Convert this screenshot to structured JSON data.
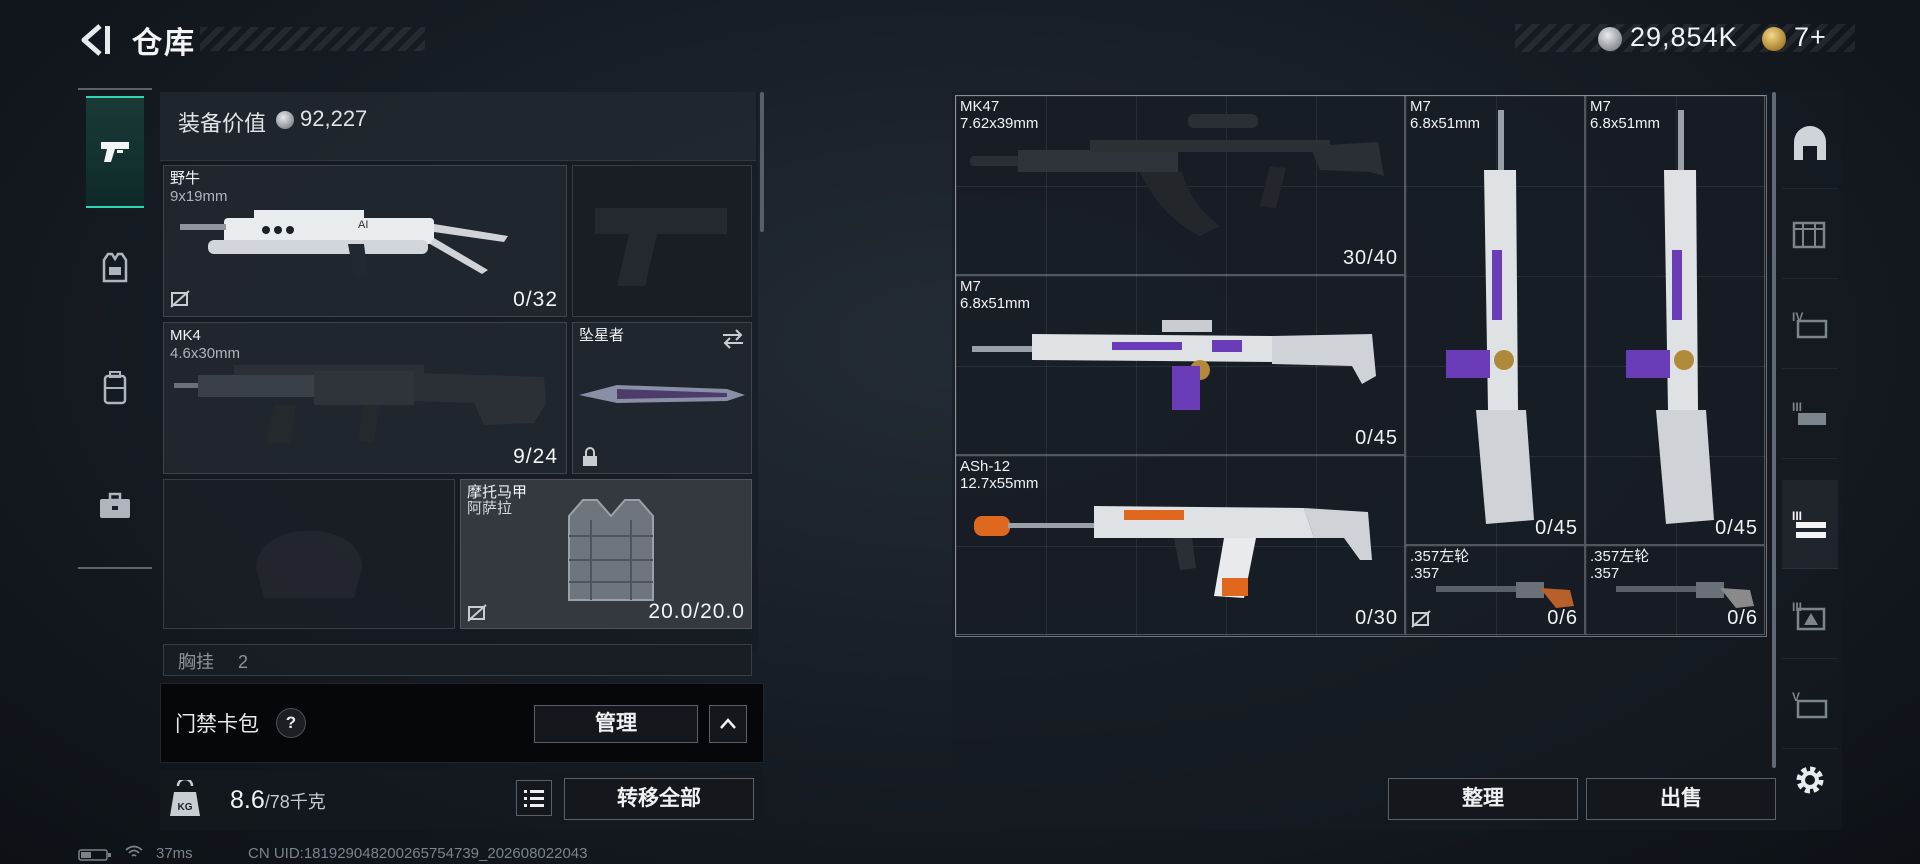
{
  "header": {
    "title": "仓库",
    "currency": [
      {
        "icon": "silver-coin-icon",
        "value": "29,854K"
      },
      {
        "icon": "gold-coin-icon",
        "value": "7+"
      }
    ]
  },
  "left_rail": {
    "tabs": [
      {
        "name": "weapons-tab",
        "icon": "pistol-icon",
        "active": true
      },
      {
        "name": "armor-tab",
        "icon": "vest-icon",
        "active": false
      },
      {
        "name": "backpack-tab",
        "icon": "backpack-icon",
        "active": false
      },
      {
        "name": "case-tab",
        "icon": "briefcase-icon",
        "active": false
      }
    ]
  },
  "loadout": {
    "value_label": "装备价值",
    "value": "92,227",
    "slots": {
      "primary1": {
        "name": "野牛",
        "caliber": "9x19mm",
        "ammo": "0/32"
      },
      "primary2": {
        "name": "MK4",
        "caliber": "4.6x30mm",
        "ammo": "9/24"
      },
      "melee": {
        "name": "坠星者"
      },
      "armor": {
        "name": "摩托马甲",
        "sub": "阿萨拉",
        "durability": "20.0/20.0"
      },
      "chest_rig": {
        "name": "胸挂",
        "count": "2"
      }
    },
    "card_bar": {
      "label": "门禁卡包",
      "help": "?",
      "manage_label": "管理",
      "expand_icon": "chevron-up-icon"
    },
    "weight": {
      "current": "8.6",
      "max": "/78千克",
      "transfer_all_label": "转移全部",
      "list_icon": "list-icon"
    }
  },
  "status": {
    "ping": "37ms",
    "uid": "CN UID:181929048200265754739_202608022043"
  },
  "storage": {
    "items": [
      {
        "name": "MK47",
        "caliber": "7.62x39mm",
        "ammo": "30/40",
        "accent": "#c8ccd0"
      },
      {
        "name": "M7",
        "caliber": "6.8x51mm",
        "ammo": "0/45",
        "accent": "#7a3cc8"
      },
      {
        "name": "M7",
        "caliber": "6.8x51mm",
        "ammo": "0/45",
        "accent": "#7a3cc8"
      },
      {
        "name": "M7",
        "caliber": "6.8x51mm",
        "ammo": "0/45",
        "accent": "#7a3cc8"
      },
      {
        "name": "ASh-12",
        "caliber": "12.7x55mm",
        "ammo": "0/30",
        "accent": "#e0671e"
      },
      {
        "name": ".357左轮",
        "caliber": ".357",
        "ammo": "0/6",
        "accent": "#b8602a"
      },
      {
        "name": ".357左轮",
        "caliber": ".357",
        "ammo": "0/6",
        "accent": "#8a8a8a"
      }
    ],
    "sort_label": "整理",
    "sell_label": "出售",
    "category_tabs": [
      {
        "name": "all",
        "icon": "bunker-icon"
      },
      {
        "name": "container",
        "icon": "crate-icon"
      },
      {
        "name": "level-iv",
        "icon": "iv-icon"
      },
      {
        "name": "level-iii",
        "icon": "iii-icon"
      },
      {
        "name": "level-ii",
        "icon": "ii-icon",
        "active": true
      },
      {
        "name": "level-iii-b",
        "icon": "iii-b-icon"
      },
      {
        "name": "level-v",
        "icon": "v-icon"
      }
    ],
    "settings_icon": "gear-icon"
  }
}
